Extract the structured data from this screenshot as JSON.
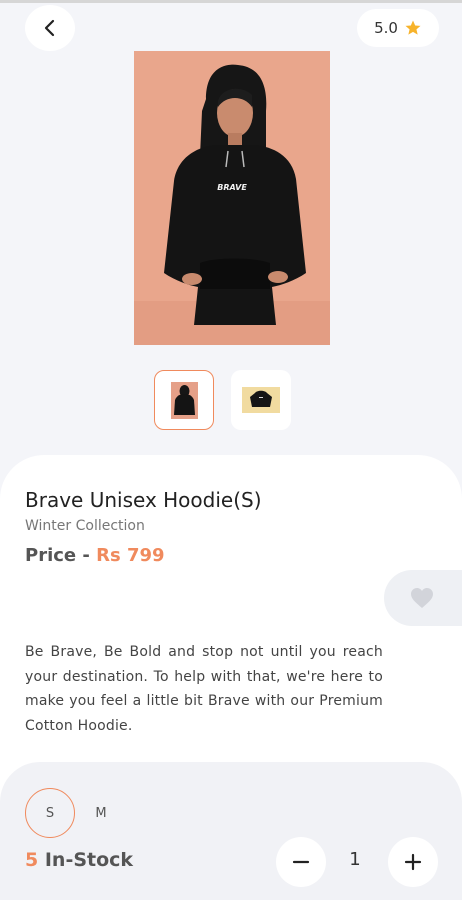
{
  "header": {
    "back_icon": "chevron-left-icon",
    "rating": {
      "value": "5.0",
      "icon": "star-icon",
      "icon_color": "#f7b32b"
    }
  },
  "gallery": {
    "main_image": "model-in-black-hoodie-photo",
    "hoodie_print": "BRAVE",
    "thumbnails": [
      "hoodie-model-thumbnail",
      "hoodie-flat-thumbnail"
    ],
    "selected_index": 0
  },
  "product": {
    "title": "Brave Unisex Hoodie(S)",
    "collection": "Winter Collection",
    "price_label": "Price - ",
    "price_value": "Rs 799",
    "description": "Be Brave, Be Bold and stop not until you reach your destination. To help with that, we're here to make you feel a little bit Brave with our Premium Cotton Hoodie."
  },
  "favorite": {
    "icon": "heart-icon"
  },
  "sizes": {
    "options": [
      "S",
      "M"
    ],
    "selected": "S"
  },
  "stock": {
    "count": "5",
    "label": " In-Stock"
  },
  "quantity": {
    "value": "1",
    "minus_icon": "minus-icon",
    "plus_icon": "plus-icon"
  },
  "colors": {
    "accent": "#f08a5d",
    "background": "#f4f5f9",
    "card": "#ffffff",
    "star": "#f7b32b"
  }
}
